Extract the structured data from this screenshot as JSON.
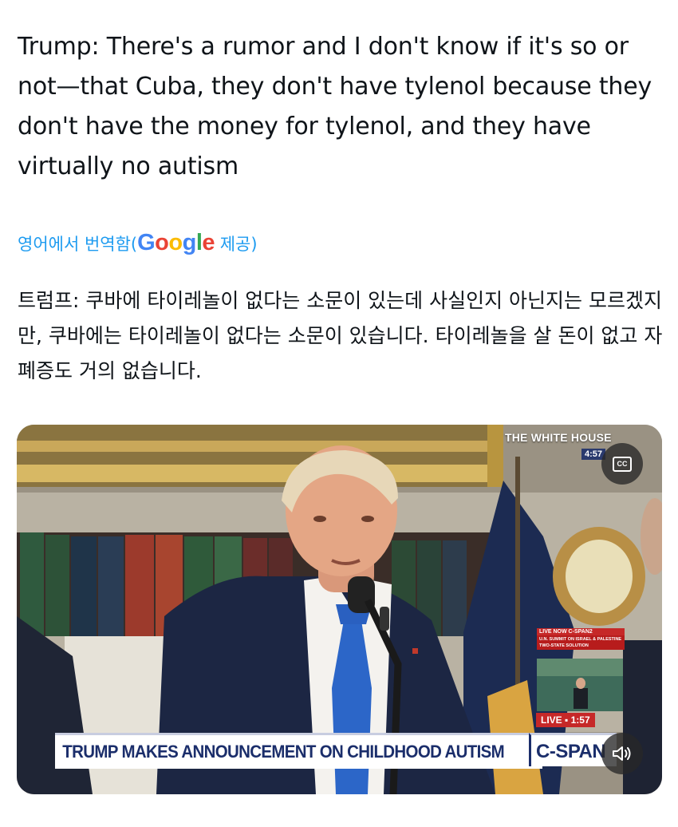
{
  "tweet": {
    "text": "Trump: There's a rumor and I don't know if it's so or not—that Cuba, they don't have tylenol because they don't have the money for tylenol, and they have virtually no autism"
  },
  "translation": {
    "label_prefix": "영어에서 번역함(",
    "provider_logo": "Google",
    "label_suffix": " 제공)",
    "text": "트럼프: 쿠바에 타이레놀이 없다는 소문이 있는데 사실인지 아닌지는 모르겠지만, 쿠바에는 타이레놀이 없다는 소문이 있습니다. 타이레놀을 살 돈이 없고 자폐증도 거의 없습니다."
  },
  "media": {
    "network_badge": "THE WHITE HOUSE",
    "badge_time": "4:57",
    "chyron": "TRUMP MAKES ANNOUNCEMENT ON CHILDHOOD AUTISM",
    "network_logo": "C-SPAN",
    "live_now_label": "LIVE NOW C-SPAN2",
    "live_now_desc": "U.N. SUMMIT ON ISRAEL & PALESTINE TWO-STATE SOLUTION",
    "live_label": "LIVE ▪ 1:57",
    "cc_label": "CC",
    "cc_icon": "closed-captions-icon",
    "mute_icon": "speaker-muted-icon"
  },
  "colors": {
    "link": "#1d9bf0",
    "text": "#0f1419",
    "chyron_text": "#1b2e6b",
    "live_red": "#c62828"
  }
}
